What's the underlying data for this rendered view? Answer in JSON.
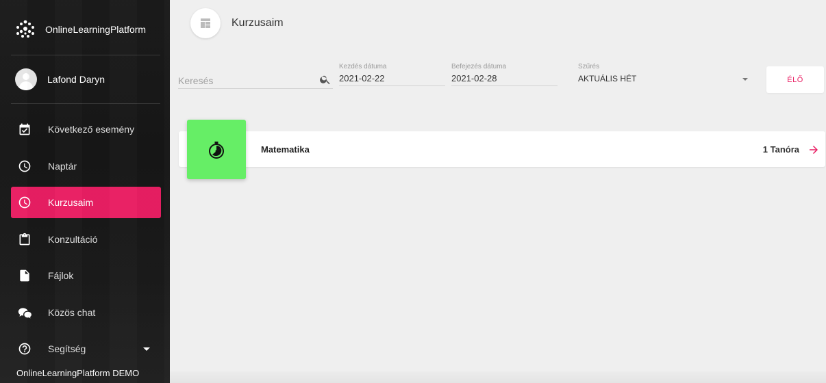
{
  "sidebar": {
    "brand_name": "OnlineLearningPlatform",
    "user_name": "Lafond Daryn",
    "items": [
      {
        "label": "Következő esemény",
        "icon": "calendar-check-icon",
        "active": false
      },
      {
        "label": "Naptár",
        "icon": "clock-icon",
        "active": false
      },
      {
        "label": "Kurzusaim",
        "icon": "clock-icon",
        "active": true
      },
      {
        "label": "Konzultáció",
        "icon": "clipboard-icon",
        "active": false
      },
      {
        "label": "Fájlok",
        "icon": "file-icon",
        "active": false
      },
      {
        "label": "Közös chat",
        "icon": "chat-icon",
        "active": false
      },
      {
        "label": "Segítség",
        "icon": "help-icon",
        "active": false
      }
    ],
    "footer": "OnlineLearningPlatform DEMO"
  },
  "header": {
    "title": "Kurzusaim",
    "icon": "dashboard-icon"
  },
  "filters": {
    "search_placeholder": "Keresés",
    "start_label": "Kezdés dátuma",
    "start_value": "2021-02-22",
    "end_label": "Befejezés dátuma",
    "end_value": "2021-02-28",
    "filter_label": "Szűrés",
    "filter_value": "AKTUÁLIS HÉT",
    "live_label": "ÉLŐ"
  },
  "courses": [
    {
      "name": "Matematika",
      "lessons": "1 Tanóra",
      "icon": "stopwatch-icon",
      "color": "#66ee66"
    }
  ],
  "colors": {
    "accent": "#e91e63",
    "sidebar_bg": "#1b1b1b",
    "page_bg": "#efefef"
  }
}
